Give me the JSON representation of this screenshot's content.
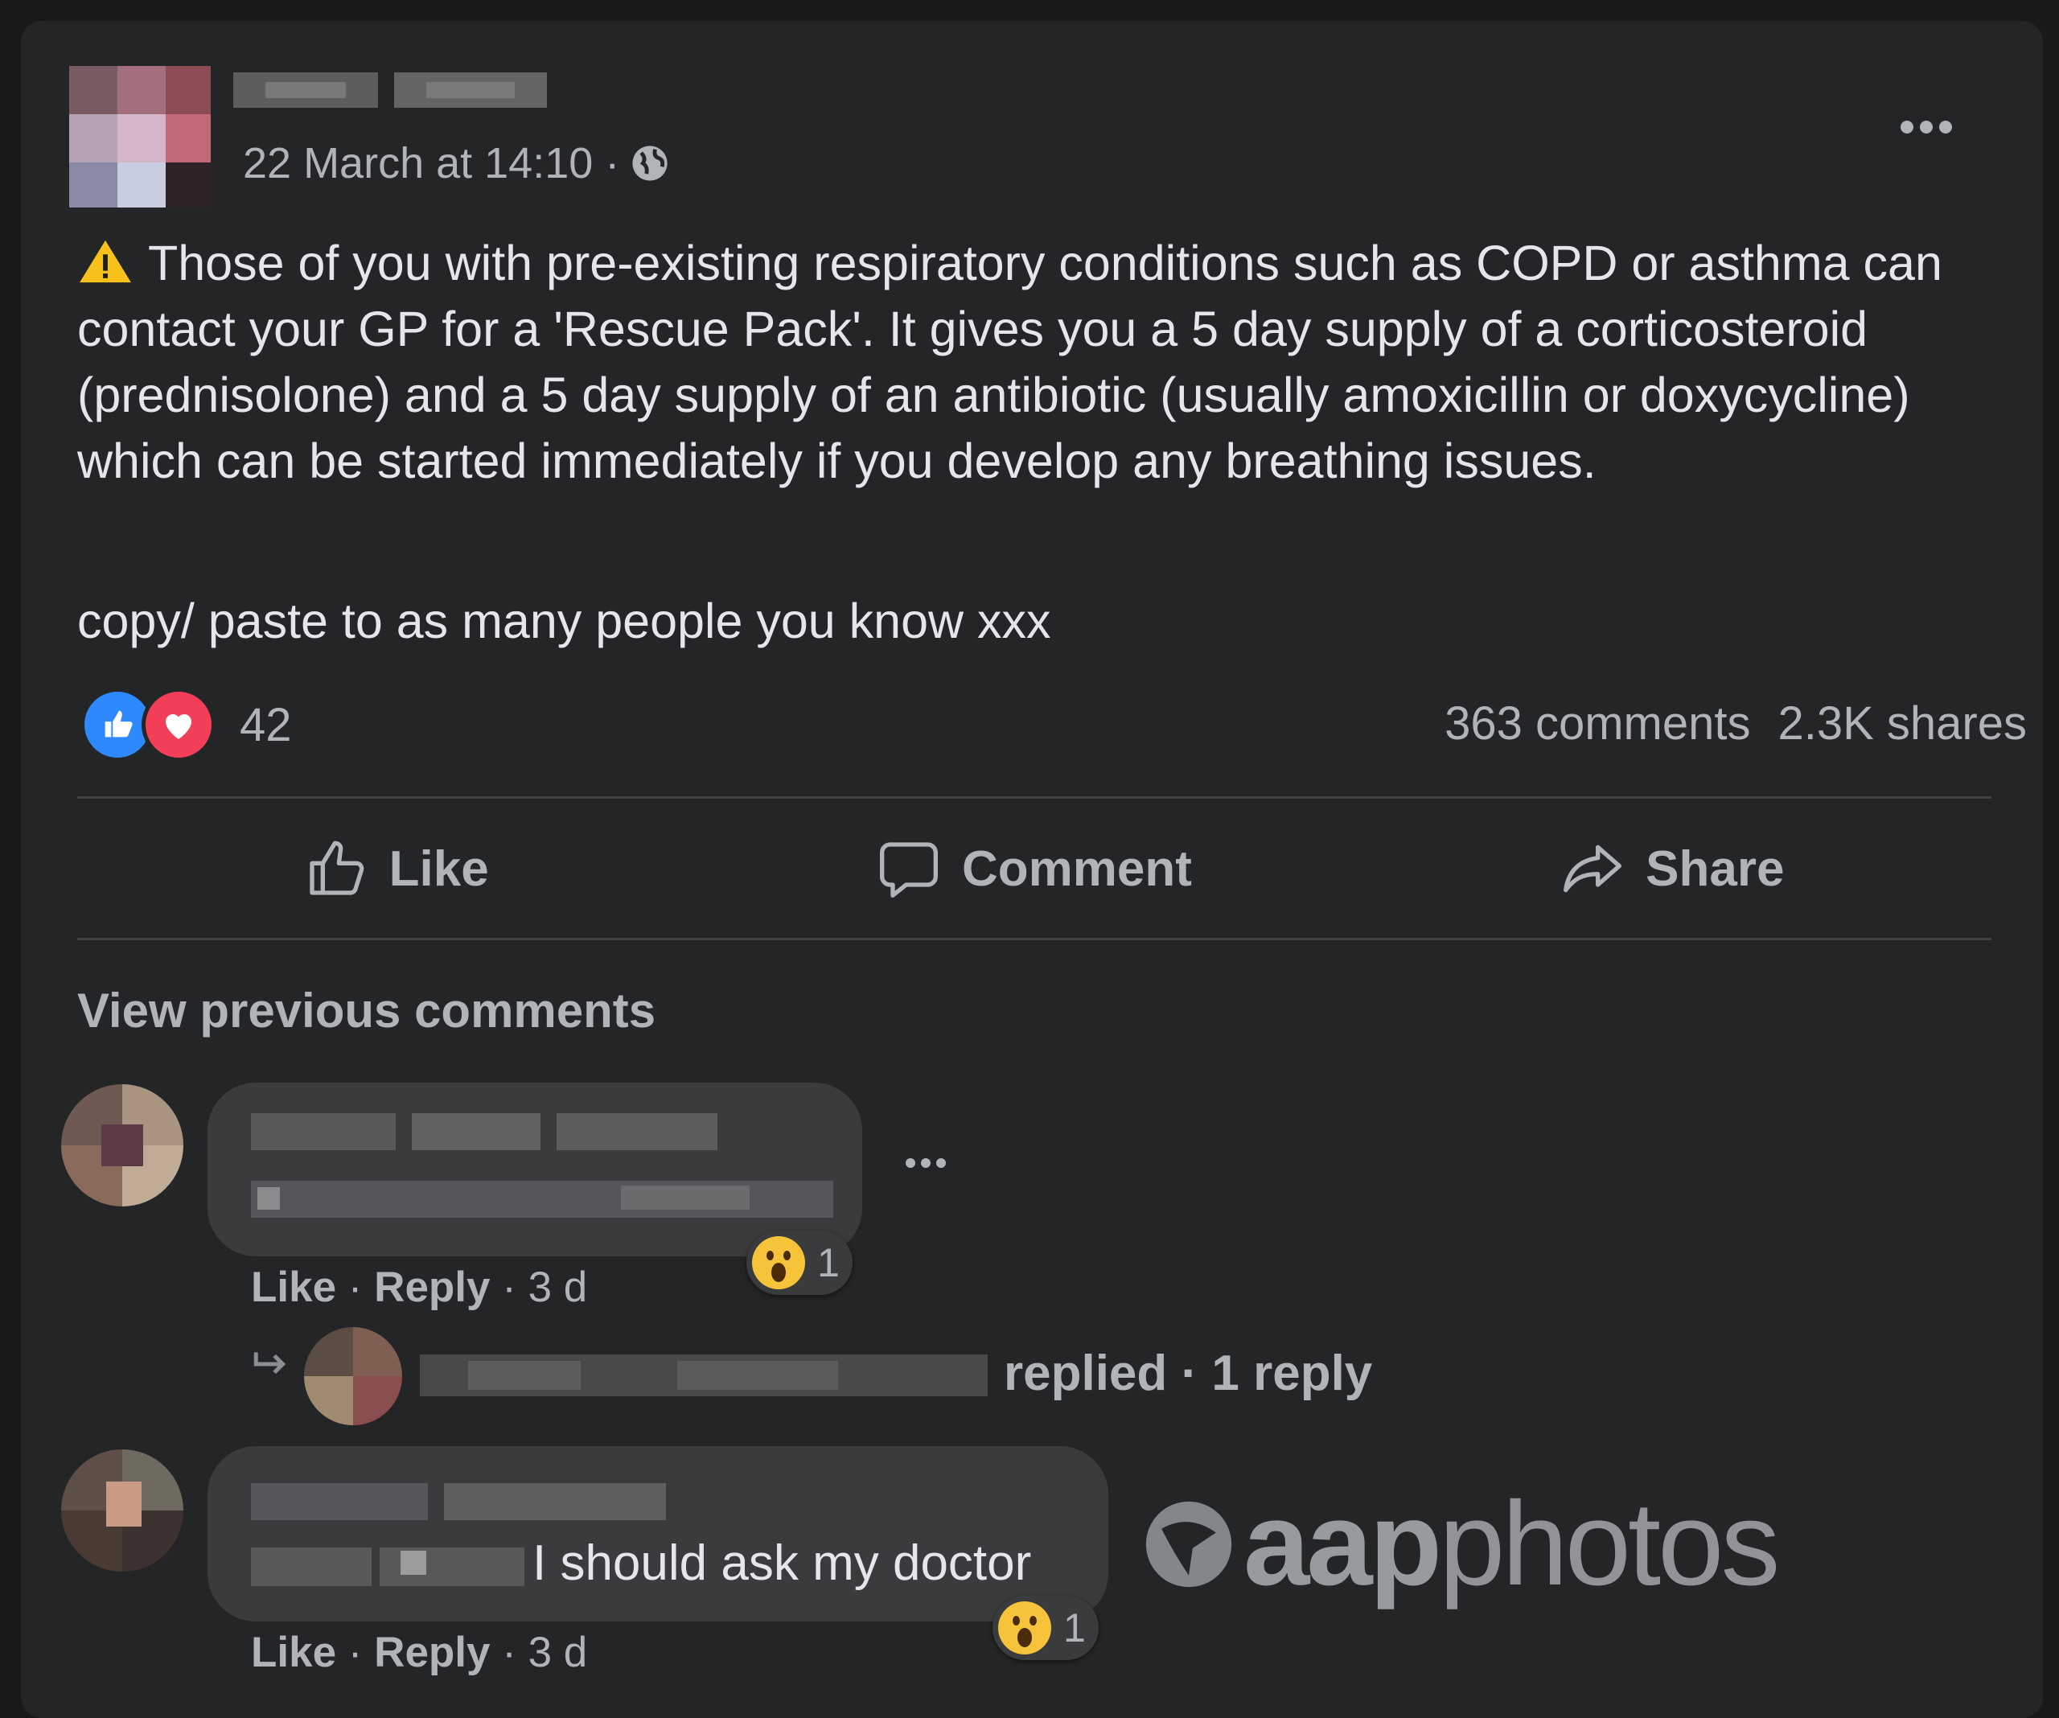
{
  "post": {
    "timestamp": "22 March at 14:10 ·",
    "audience_icon": "globe-icon",
    "body_line1": "Those of you with pre-existing respiratory conditions such as COPD or asthma can contact your GP for a 'Rescue Pack'. It gives you a 5 day supply of a corticosteroid (prednisolone) and a 5 day supply of an antibiotic (usually amoxicillin or doxycycline) which can be started immediately if you develop any breathing issues.",
    "body_line2": "copy/ paste to as many people you know xxx",
    "reaction_count": "42",
    "comments_count": "363 comments",
    "shares_count": "2.3K shares"
  },
  "actions": {
    "like": "Like",
    "comment": "Comment",
    "share": "Share"
  },
  "comments": {
    "view_previous": "View previous comments",
    "items": [
      {
        "like_label": "Like",
        "reply_label": "Reply",
        "age": "· 3 d",
        "reaction_count": "1"
      },
      {
        "text": "I should ask my doctor",
        "like_label": "Like",
        "reply_label": "Reply",
        "age": "· 3 d",
        "reaction_count": "1"
      }
    ],
    "replies_summary": "replied · 1 reply"
  },
  "watermark": {
    "brand_bold": "aap",
    "brand_light": "photos"
  },
  "colors": {
    "page_bg": "#18191a",
    "card_bg": "#242526",
    "bubble_bg": "#3a3b3c",
    "primary_text": "#e4e6eb",
    "secondary_text": "#b0b3b8",
    "like_blue": "#2e89ff",
    "love_red": "#f33e58"
  }
}
